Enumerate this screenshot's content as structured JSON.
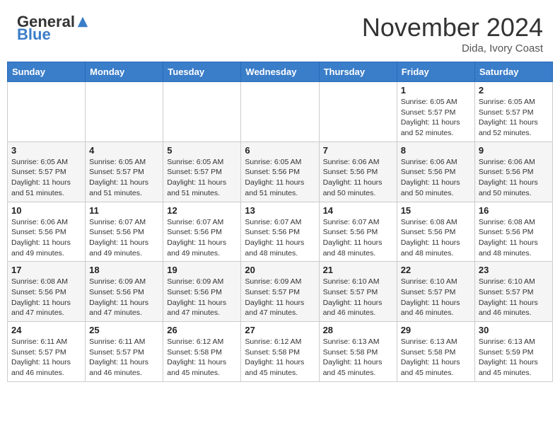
{
  "header": {
    "logo_general": "General",
    "logo_blue": "Blue",
    "month_title": "November 2024",
    "location": "Dida, Ivory Coast"
  },
  "days_of_week": [
    "Sunday",
    "Monday",
    "Tuesday",
    "Wednesday",
    "Thursday",
    "Friday",
    "Saturday"
  ],
  "weeks": [
    [
      {
        "day": "",
        "info": ""
      },
      {
        "day": "",
        "info": ""
      },
      {
        "day": "",
        "info": ""
      },
      {
        "day": "",
        "info": ""
      },
      {
        "day": "",
        "info": ""
      },
      {
        "day": "1",
        "info": "Sunrise: 6:05 AM\nSunset: 5:57 PM\nDaylight: 11 hours and 52 minutes."
      },
      {
        "day": "2",
        "info": "Sunrise: 6:05 AM\nSunset: 5:57 PM\nDaylight: 11 hours and 52 minutes."
      }
    ],
    [
      {
        "day": "3",
        "info": "Sunrise: 6:05 AM\nSunset: 5:57 PM\nDaylight: 11 hours and 51 minutes."
      },
      {
        "day": "4",
        "info": "Sunrise: 6:05 AM\nSunset: 5:57 PM\nDaylight: 11 hours and 51 minutes."
      },
      {
        "day": "5",
        "info": "Sunrise: 6:05 AM\nSunset: 5:57 PM\nDaylight: 11 hours and 51 minutes."
      },
      {
        "day": "6",
        "info": "Sunrise: 6:05 AM\nSunset: 5:56 PM\nDaylight: 11 hours and 51 minutes."
      },
      {
        "day": "7",
        "info": "Sunrise: 6:06 AM\nSunset: 5:56 PM\nDaylight: 11 hours and 50 minutes."
      },
      {
        "day": "8",
        "info": "Sunrise: 6:06 AM\nSunset: 5:56 PM\nDaylight: 11 hours and 50 minutes."
      },
      {
        "day": "9",
        "info": "Sunrise: 6:06 AM\nSunset: 5:56 PM\nDaylight: 11 hours and 50 minutes."
      }
    ],
    [
      {
        "day": "10",
        "info": "Sunrise: 6:06 AM\nSunset: 5:56 PM\nDaylight: 11 hours and 49 minutes."
      },
      {
        "day": "11",
        "info": "Sunrise: 6:07 AM\nSunset: 5:56 PM\nDaylight: 11 hours and 49 minutes."
      },
      {
        "day": "12",
        "info": "Sunrise: 6:07 AM\nSunset: 5:56 PM\nDaylight: 11 hours and 49 minutes."
      },
      {
        "day": "13",
        "info": "Sunrise: 6:07 AM\nSunset: 5:56 PM\nDaylight: 11 hours and 48 minutes."
      },
      {
        "day": "14",
        "info": "Sunrise: 6:07 AM\nSunset: 5:56 PM\nDaylight: 11 hours and 48 minutes."
      },
      {
        "day": "15",
        "info": "Sunrise: 6:08 AM\nSunset: 5:56 PM\nDaylight: 11 hours and 48 minutes."
      },
      {
        "day": "16",
        "info": "Sunrise: 6:08 AM\nSunset: 5:56 PM\nDaylight: 11 hours and 48 minutes."
      }
    ],
    [
      {
        "day": "17",
        "info": "Sunrise: 6:08 AM\nSunset: 5:56 PM\nDaylight: 11 hours and 47 minutes."
      },
      {
        "day": "18",
        "info": "Sunrise: 6:09 AM\nSunset: 5:56 PM\nDaylight: 11 hours and 47 minutes."
      },
      {
        "day": "19",
        "info": "Sunrise: 6:09 AM\nSunset: 5:56 PM\nDaylight: 11 hours and 47 minutes."
      },
      {
        "day": "20",
        "info": "Sunrise: 6:09 AM\nSunset: 5:57 PM\nDaylight: 11 hours and 47 minutes."
      },
      {
        "day": "21",
        "info": "Sunrise: 6:10 AM\nSunset: 5:57 PM\nDaylight: 11 hours and 46 minutes."
      },
      {
        "day": "22",
        "info": "Sunrise: 6:10 AM\nSunset: 5:57 PM\nDaylight: 11 hours and 46 minutes."
      },
      {
        "day": "23",
        "info": "Sunrise: 6:10 AM\nSunset: 5:57 PM\nDaylight: 11 hours and 46 minutes."
      }
    ],
    [
      {
        "day": "24",
        "info": "Sunrise: 6:11 AM\nSunset: 5:57 PM\nDaylight: 11 hours and 46 minutes."
      },
      {
        "day": "25",
        "info": "Sunrise: 6:11 AM\nSunset: 5:57 PM\nDaylight: 11 hours and 46 minutes."
      },
      {
        "day": "26",
        "info": "Sunrise: 6:12 AM\nSunset: 5:58 PM\nDaylight: 11 hours and 45 minutes."
      },
      {
        "day": "27",
        "info": "Sunrise: 6:12 AM\nSunset: 5:58 PM\nDaylight: 11 hours and 45 minutes."
      },
      {
        "day": "28",
        "info": "Sunrise: 6:13 AM\nSunset: 5:58 PM\nDaylight: 11 hours and 45 minutes."
      },
      {
        "day": "29",
        "info": "Sunrise: 6:13 AM\nSunset: 5:58 PM\nDaylight: 11 hours and 45 minutes."
      },
      {
        "day": "30",
        "info": "Sunrise: 6:13 AM\nSunset: 5:59 PM\nDaylight: 11 hours and 45 minutes."
      }
    ]
  ]
}
